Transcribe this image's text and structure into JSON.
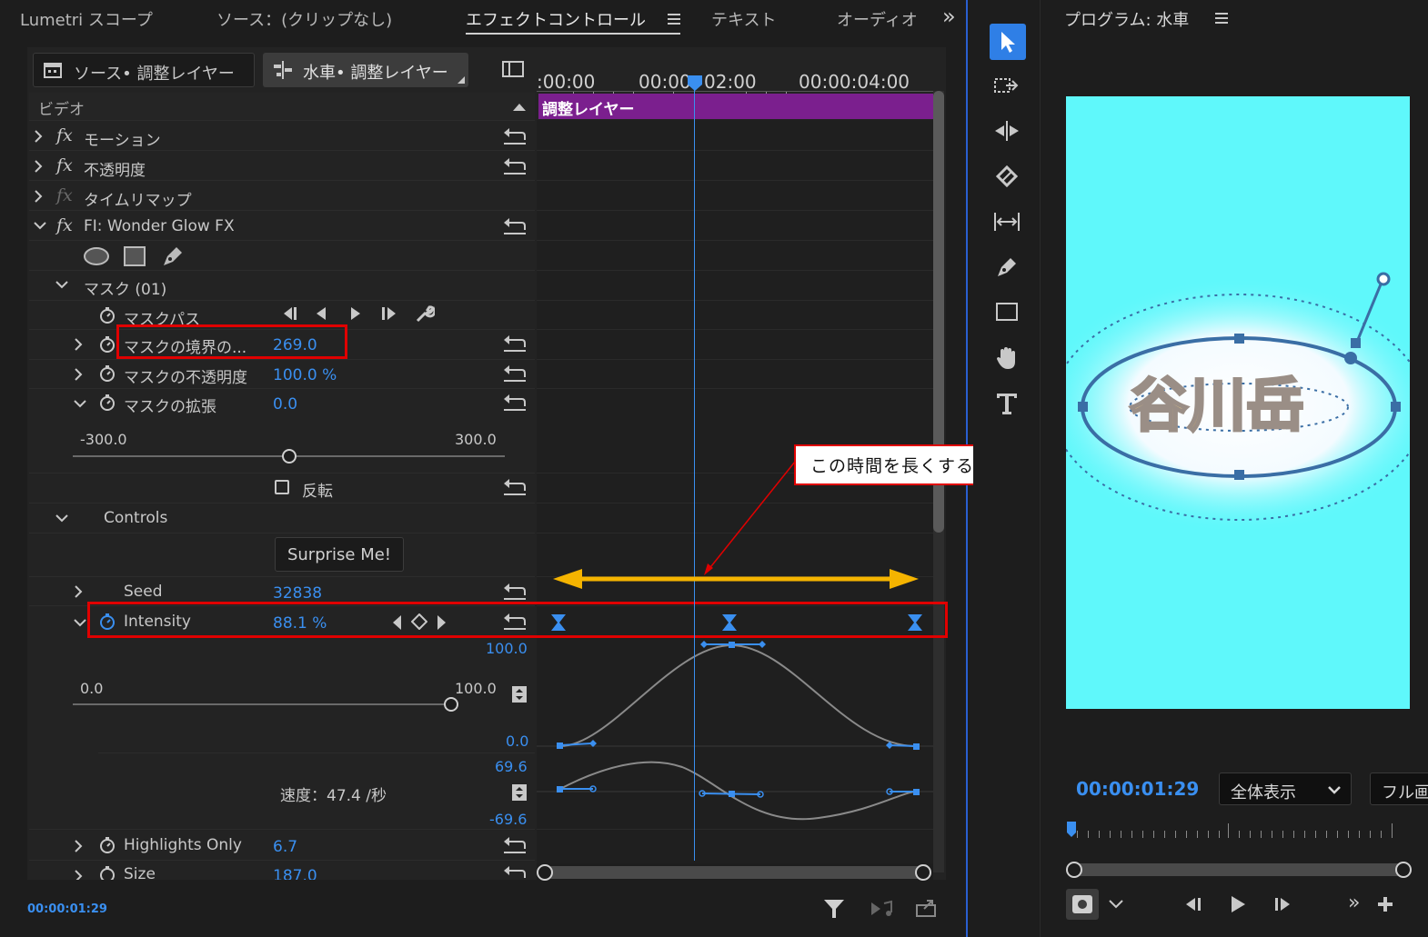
{
  "tabs": {
    "lumetri": "Lumetri スコープ",
    "source": "ソース：(クリップなし)",
    "effect_controls": "エフェクトコントロール",
    "text": "テキスト",
    "audio": "オーディオ",
    "overflow": "»"
  },
  "clip_selector": {
    "source": "ソース• 調整レイヤー",
    "sequence": "水車• 調整レイヤー"
  },
  "timeline_ruler": {
    "t0": ":00:00",
    "t1": "00:00",
    "t2": "02:00",
    "t3": "00:00:04:00"
  },
  "clip_bar": "調整レイヤー",
  "effects": {
    "video_header": "ビデオ",
    "fx_label": "fx",
    "motion": "モーション",
    "opacity": "不透明度",
    "time_remap": "タイムリマップ",
    "wonder_glow": "FI: Wonder Glow FX",
    "mask": "マスク (01)",
    "mask_path": "マスクパス",
    "mask_feather": {
      "label": "マスクの境界の...",
      "value": "269.0"
    },
    "mask_opacity": {
      "label": "マスクの不透明度",
      "value": "100.0 %"
    },
    "mask_expansion": {
      "label": "マスクの拡張",
      "value": "0.0"
    },
    "expansion_slider": {
      "min": "-300.0",
      "max": "300.0",
      "position": 0.5
    },
    "invert": "反転",
    "controls": "Controls",
    "surprise": "Surprise Me!",
    "seed": {
      "label": "Seed",
      "value": "32838"
    },
    "intensity": {
      "label": "Intensity",
      "value": "88.1 %"
    },
    "intensity_slider": {
      "min": "0.0",
      "max": "100.0",
      "position": 0.881
    },
    "graph_value_max": "100.0",
    "graph_value_min": "0.0",
    "velocity_label": "速度：47.4 /秒",
    "velocity_max": "69.6",
    "velocity_min": "-69.6",
    "highlights_only": {
      "label": "Highlights Only",
      "value": "6.7"
    },
    "size": {
      "label": "Size",
      "value": "187.0"
    }
  },
  "annotation": "この時間を長くする",
  "bottom_timecode": "00:00:01:29",
  "program": {
    "title": "プログラム: 水車",
    "timecode": "00:00:01:29",
    "zoom": "全体表示",
    "quality": "フル画",
    "logo_text": "谷川岳"
  },
  "colors": {
    "accent_blue": "#3a8ff0",
    "clip_purple": "#7b1f8e",
    "highlight_red": "#e00000",
    "arrow_gold": "#f5b400",
    "preview_cyan": "#5ff8fb"
  }
}
